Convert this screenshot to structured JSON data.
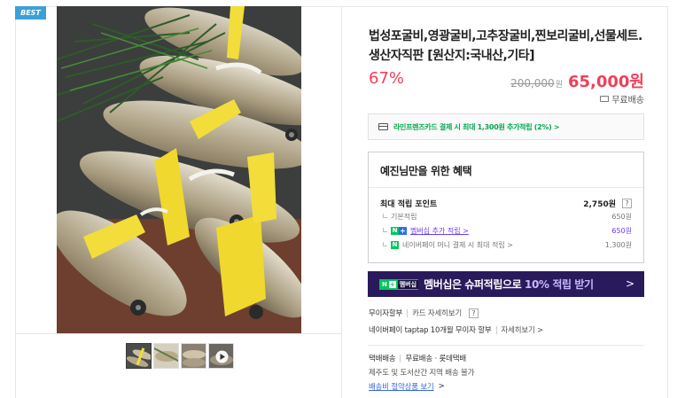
{
  "badge": {
    "label": "BEST"
  },
  "gallery": {
    "main_alt": "굴비 선물세트",
    "thumbnails": [
      {
        "kind": "image",
        "active": true
      },
      {
        "kind": "image",
        "active": false
      },
      {
        "kind": "image",
        "active": false
      },
      {
        "kind": "video",
        "active": false
      }
    ]
  },
  "product": {
    "title": "법성포굴비,영광굴비,고추장굴비,찐보리굴비,선물세트. 생산자직판 [원산지:국내산,기타]",
    "discount": "67%",
    "original_price": "200,000",
    "original_unit": "원",
    "sale_price": "65,000원",
    "shipping": "무료배송"
  },
  "card_promo": {
    "text": "라인프렌즈카드 결제 시 최대 1,300원 추가적립 (2%) >"
  },
  "benefits": {
    "title": "예진님만을 위한 혜택",
    "max_points_label": "최대 적립 포인트",
    "max_points_value": "2,750원",
    "help": "?",
    "rows": [
      {
        "label": "기본적립",
        "value": "650원"
      },
      {
        "label": "멤버십 추가 적립 >",
        "value": "650원"
      },
      {
        "label": "네이버페이 머니 결제 시 최대 적립 >",
        "value": "1,300원"
      }
    ]
  },
  "membership_banner": {
    "tag_n": "N",
    "tag_plus": "+",
    "tag_label": "멤버십",
    "text_before": "멤버십은 슈퍼적립으로 ",
    "text_highlight": "10% 적립 받기",
    "arrow": ">"
  },
  "installment": {
    "label": "무이자할부",
    "card_detail": "카드 자세히보기",
    "help": "?",
    "naverpay": "네이버페이 taptap 10개월 무이자 할부",
    "naverpay_detail": "자세히보기 >"
  },
  "delivery": {
    "type": "택배배송",
    "method": "무료배송 · 롯데택배",
    "note": "제주도 및 도서산간 지역 배송 불가",
    "link": "배송비 절약상품 보기",
    "link_arrow": ">"
  },
  "colors": {
    "accent_red": "#f0405a",
    "naver_green": "#03c75a",
    "banner_bg": "#291a5c",
    "badge_blue": "#3ca0d8"
  }
}
